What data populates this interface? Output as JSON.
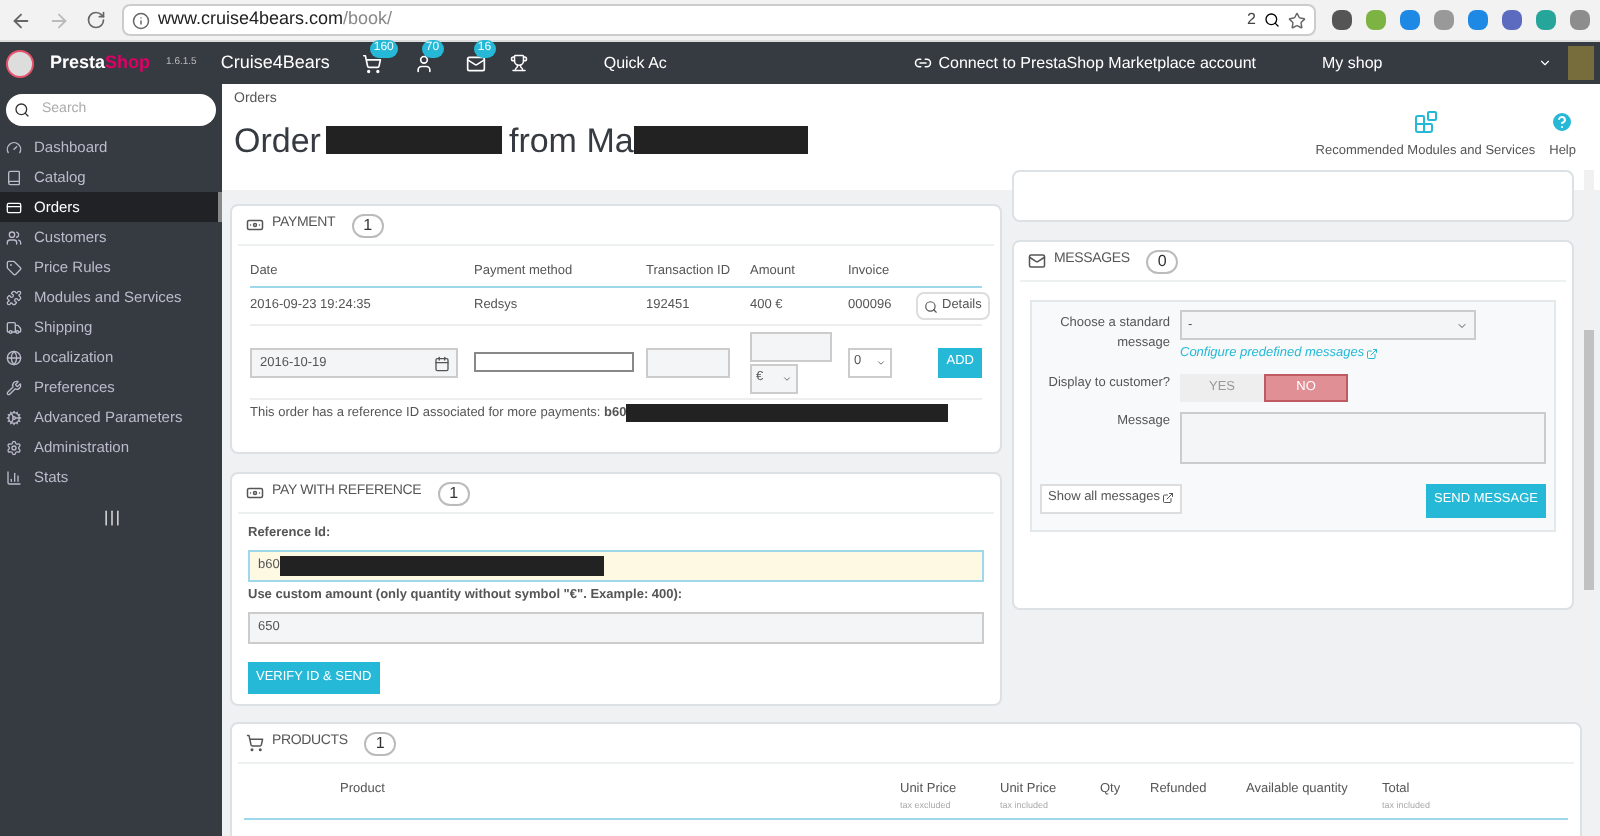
{
  "browser": {
    "url_host": "www.cruise4bears.com",
    "url_path": "/book/",
    "zoom_badge": "2"
  },
  "topbar": {
    "logo_a": "Presta",
    "logo_b": "Shop",
    "version": "1.6.1.5",
    "shop_name": "Cruise4Bears",
    "badges": [
      "160",
      "70",
      "16"
    ],
    "quick_access": "Quick Ac",
    "connect": "Connect to PrestaShop Marketplace account",
    "my_shop": "My shop"
  },
  "sidebar": {
    "search": {
      "placeholder": "Search"
    },
    "items": [
      {
        "label": "Dashboard",
        "selected": false
      },
      {
        "label": "Catalog",
        "selected": false
      },
      {
        "label": "Orders",
        "selected": true
      },
      {
        "label": "Customers",
        "selected": false
      },
      {
        "label": "Price Rules",
        "selected": false
      },
      {
        "label": "Modules and Services",
        "selected": false
      },
      {
        "label": "Shipping",
        "selected": false
      },
      {
        "label": "Localization",
        "selected": false
      },
      {
        "label": "Preferences",
        "selected": false
      },
      {
        "label": "Advanced Parameters",
        "selected": false
      },
      {
        "label": "Administration",
        "selected": false
      },
      {
        "label": "Stats",
        "selected": false
      }
    ]
  },
  "header": {
    "breadcrumb": "Orders",
    "title_start": "Order",
    "title_middle": "from Ma",
    "toolbar": [
      "Recommended Modules and Services",
      "Help"
    ]
  },
  "payment": {
    "title": "PAYMENT",
    "count": "1",
    "columns": [
      "Date",
      "Payment method",
      "Transaction ID",
      "Amount",
      "Invoice"
    ],
    "rows": [
      [
        "2016-09-23 19:24:35",
        "Redsys",
        "192451",
        "400 €",
        "000096"
      ]
    ],
    "details": "Details",
    "form": {
      "date": "2016-10-19",
      "currency": "€",
      "invoice": "0",
      "add": "ADD"
    },
    "note": "This order has a reference ID associated for more payments: **b60**"
  },
  "pay_reference": {
    "title": "PAY WITH REFERENCE",
    "count": "1",
    "ref_label": "Reference Id:",
    "ref_value": "b60",
    "amount_label": "Use custom amount (only quantity without symbol \"€\". Example: 400):",
    "amount_value": "650",
    "button": "VERIFY ID & SEND"
  },
  "messages": {
    "title": "MESSAGES",
    "count": "0",
    "choose_label": "Choose a standard message",
    "select_value": "-",
    "configure_link": "Configure predefined messages",
    "display_label": "Display to customer?",
    "toggle": [
      {
        "label": "YES",
        "selected": false
      },
      {
        "label": "NO",
        "selected": true
      }
    ],
    "message_label": "Message",
    "show_all": "Show all messages",
    "send": "SEND MESSAGE"
  },
  "products": {
    "title": "PRODUCTS",
    "count": "1",
    "columns": [
      {
        "label": "Product"
      },
      {
        "label": "Unit Price",
        "sub": "tax excluded"
      },
      {
        "label": "Unit Price",
        "sub": "tax included"
      },
      {
        "label": "Qty"
      },
      {
        "label": "Refunded"
      },
      {
        "label": "Available quantity"
      },
      {
        "label": "Total",
        "sub": "tax included"
      }
    ]
  }
}
